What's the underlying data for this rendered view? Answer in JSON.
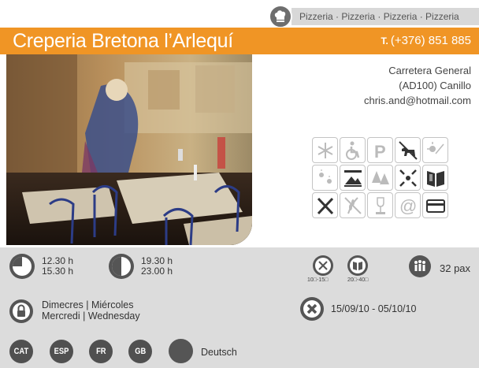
{
  "header": {
    "categories": "Pizzeria · Pizzeria · Pizzeria · Pizzeria",
    "title": "Creperia Bretona l’Arlequí",
    "phone_prefix": "T.",
    "phone_number": "(+376) 851 885"
  },
  "address": {
    "line1": "Carretera General",
    "line2": "(AD100) Canillo",
    "email": "chris.and@hotmail.com"
  },
  "facilities": [
    {
      "name": "air-conditioning-icon",
      "active": false
    },
    {
      "name": "wheelchair-access-icon",
      "active": false
    },
    {
      "name": "parking-icon",
      "active": false
    },
    {
      "name": "pets-allowed-icon",
      "active": true
    },
    {
      "name": "terrace-icon",
      "active": false
    },
    {
      "name": "sun-terrace-icon",
      "active": false
    },
    {
      "name": "mountain-view-icon",
      "active": true
    },
    {
      "name": "forest-icon",
      "active": false
    },
    {
      "name": "center-location-icon",
      "active": true
    },
    {
      "name": "menu-book-icon",
      "active": true
    },
    {
      "name": "cutlery-icon",
      "active": true
    },
    {
      "name": "gluten-free-icon",
      "active": true
    },
    {
      "name": "wine-icon",
      "active": false
    },
    {
      "name": "email-icon",
      "active": false
    },
    {
      "name": "credit-card-icon",
      "active": true
    }
  ],
  "schedule": {
    "lunch_open": "12.30 h",
    "lunch_close": "15.30 h",
    "dinner_open": "19.30 h",
    "dinner_close": "23.00 h"
  },
  "prices": {
    "menu_price": "10□-15□",
    "carte_price": "20□-40□",
    "capacity": "32 pax"
  },
  "closing": {
    "day_ca_es": "Dimecres | Miércoles",
    "day_fr_en": "Mercredi | Wednesday",
    "vacation": "15/09/10 - 05/10/10"
  },
  "languages": {
    "items": [
      "CAT",
      "ESP",
      "FR",
      "GB"
    ],
    "other": "Deutsch"
  },
  "colors": {
    "accent": "#f09525",
    "panel": "#dcdcdc",
    "icon_dark": "#555555"
  }
}
